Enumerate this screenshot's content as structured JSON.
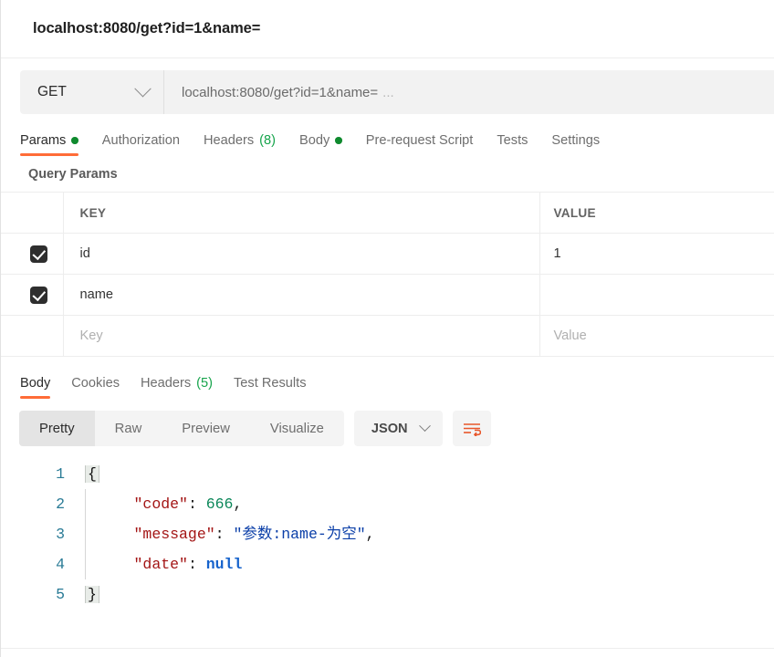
{
  "request": {
    "title": "localhost:8080/get?id=1&name=",
    "method": "GET",
    "url": "localhost:8080/get?id=1&name=",
    "url_ellipsis": "...",
    "tabs": [
      {
        "label": "Params",
        "dot": true,
        "count": "",
        "active": true
      },
      {
        "label": "Authorization",
        "dot": false,
        "count": "",
        "active": false
      },
      {
        "label": "Headers",
        "dot": false,
        "count": "(8)",
        "active": false
      },
      {
        "label": "Body",
        "dot": true,
        "count": "",
        "active": false
      },
      {
        "label": "Pre-request Script",
        "dot": false,
        "count": "",
        "active": false
      },
      {
        "label": "Tests",
        "dot": false,
        "count": "",
        "active": false
      },
      {
        "label": "Settings",
        "dot": false,
        "count": "",
        "active": false
      }
    ]
  },
  "query_params": {
    "section_label": "Query Params",
    "headers": {
      "key": "KEY",
      "value": "VALUE"
    },
    "rows": [
      {
        "checked": true,
        "key": "id",
        "value": "1"
      },
      {
        "checked": true,
        "key": "name",
        "value": ""
      },
      {
        "checked": false,
        "key": "Key",
        "value": "Value",
        "placeholder": true
      }
    ]
  },
  "response": {
    "tabs": [
      {
        "label": "Body",
        "count": "",
        "active": true
      },
      {
        "label": "Cookies",
        "count": "",
        "active": false
      },
      {
        "label": "Headers",
        "count": "(5)",
        "active": false
      },
      {
        "label": "Test Results",
        "count": "",
        "active": false
      }
    ],
    "view_modes": [
      {
        "label": "Pretty",
        "active": true
      },
      {
        "label": "Raw",
        "active": false
      },
      {
        "label": "Preview",
        "active": false
      },
      {
        "label": "Visualize",
        "active": false
      }
    ],
    "format": "JSON",
    "wrap_icon": "word-wrap-icon",
    "body": {
      "language": "json",
      "lines": [
        {
          "n": "1",
          "content": "{"
        },
        {
          "n": "2",
          "content": "    \"code\": 666,"
        },
        {
          "n": "3",
          "content": "    \"message\": \"参数:name-为空\","
        },
        {
          "n": "4",
          "content": "    \"date\": null"
        },
        {
          "n": "5",
          "content": "}"
        }
      ],
      "parsed": {
        "code": 666,
        "message": "参数:name-为空",
        "date": null
      }
    }
  },
  "colors": {
    "accent": "#ff6c37",
    "dot_green": "#0f8a2e",
    "count_green": "#17a44c",
    "json_key": "#a31515",
    "json_number": "#098658",
    "json_string": "#0b3fa8",
    "json_null": "#1763cc",
    "gutter": "#2a7b96"
  }
}
